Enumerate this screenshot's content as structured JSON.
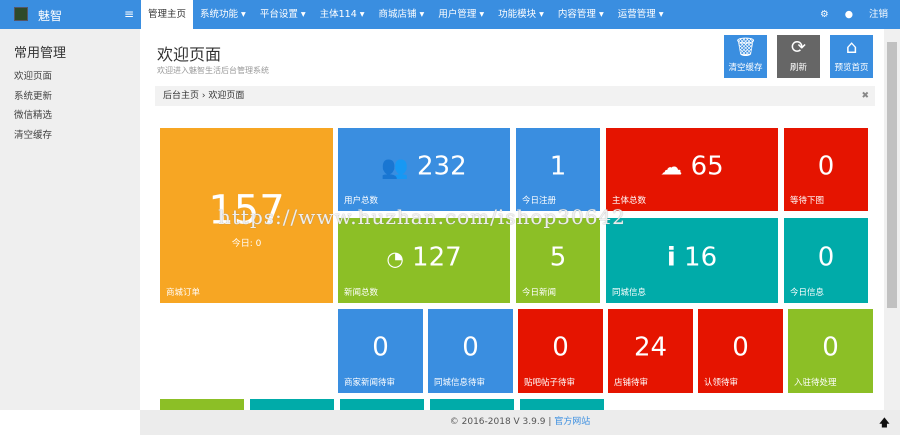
{
  "header": {
    "brand": "魅智",
    "nav": [
      "管理主页",
      "系统功能 ▾",
      "平台设置 ▾",
      "主体114 ▾",
      "商城店铺 ▾",
      "用户管理 ▾",
      "功能模块 ▾",
      "内容管理 ▾",
      "运营管理 ▾"
    ],
    "settings_icon": "⚙",
    "theme_icon": "💧",
    "logout": "注销"
  },
  "sidebar": {
    "title": "常用管理",
    "items": [
      "欢迎页面",
      "系统更新",
      "微信精选",
      "清空缓存"
    ]
  },
  "page": {
    "title": "欢迎页面",
    "subtitle": "欢迎进入魅智生活后台管理系统",
    "breadcrumb": "后台主页 › 欢迎页面",
    "close": "✖"
  },
  "buttons": {
    "clear": "清空缓存",
    "refresh": "刷新",
    "preview": "预览首页"
  },
  "tiles": {
    "orders": {
      "value": "157",
      "sub": "今日: 0",
      "label": "商城订单"
    },
    "users": {
      "value": "232",
      "label": "用户总数",
      "icon": "👥"
    },
    "today_reg": {
      "value": "1",
      "label": "今日注册"
    },
    "subjects": {
      "value": "65",
      "label": "主体总数",
      "icon": "☁"
    },
    "pending": {
      "value": "0",
      "label": "等待下图"
    },
    "news": {
      "value": "127",
      "label": "新闻总数",
      "icon": "📶"
    },
    "today_news": {
      "value": "5",
      "label": "今日新闻"
    },
    "city": {
      "value": "16",
      "label": "同城信息",
      "icon": "i"
    },
    "today_info": {
      "value": "0",
      "label": "今日信息"
    },
    "r3": [
      {
        "value": "0",
        "label": "商家新闻待审"
      },
      {
        "value": "0",
        "label": "同城信息待审"
      },
      {
        "value": "0",
        "label": "贴吧帖子待审"
      },
      {
        "value": "24",
        "label": "店铺待审"
      },
      {
        "value": "0",
        "label": "认领待审"
      },
      {
        "value": "0",
        "label": "入驻待处理"
      }
    ]
  },
  "footer": {
    "copyright": "© 2016-2018 V 3.9.9 | ",
    "link": "官方网站"
  },
  "watermark": "https://www.huzhan.com/ishop30642"
}
